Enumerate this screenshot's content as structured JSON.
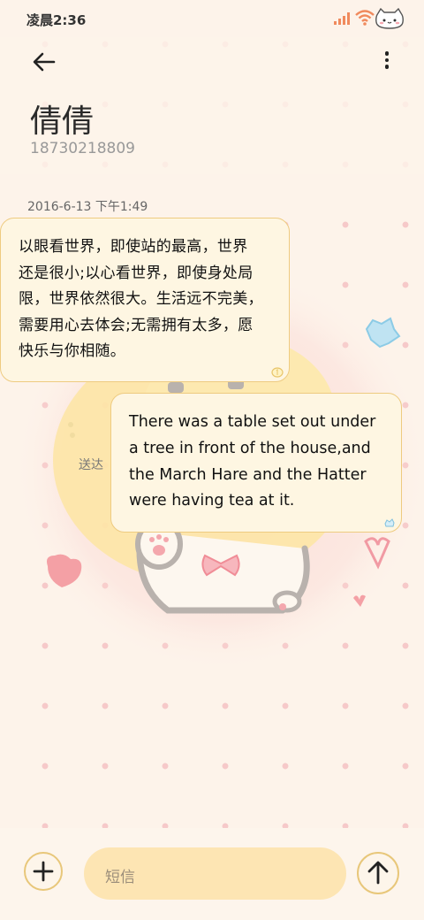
{
  "status_bar": {
    "time": "凌晨2:36",
    "icons": [
      "signal-icon",
      "wifi-icon",
      "battery-cat-icon"
    ]
  },
  "header": {
    "back_icon": "back-arrow-icon",
    "more_icon": "more-vertical-icon",
    "contact_name": "倩倩",
    "contact_number": "18730218809"
  },
  "conversation": {
    "timestamp": "2016-6-13 下午1:49",
    "messages": [
      {
        "direction": "incoming",
        "lines": [
          "以眼看世界，即使站的最高，世界",
          "还是很小;以心看世界，即使身处局",
          "限，世界依然很大。生活远不完美，",
          "需要用心去体会;无需拥有太多，愿",
          "快乐与你相随。"
        ]
      },
      {
        "direction": "outgoing",
        "status": "送达",
        "lines": [
          "There was a table set out under",
          "a tree in front of the house,and",
          "the March Hare and the Hatter",
          "were having tea at it."
        ]
      }
    ]
  },
  "composer": {
    "placeholder": "短信",
    "add_icon": "plus-icon",
    "send_icon": "send-arrow-icon"
  },
  "colors": {
    "background": "#fdf3ea",
    "bubble_fill": "#fef6e2",
    "bubble_border": "#eecb80",
    "input_fill": "#fde5b3",
    "dots": "#f6c9c9"
  }
}
